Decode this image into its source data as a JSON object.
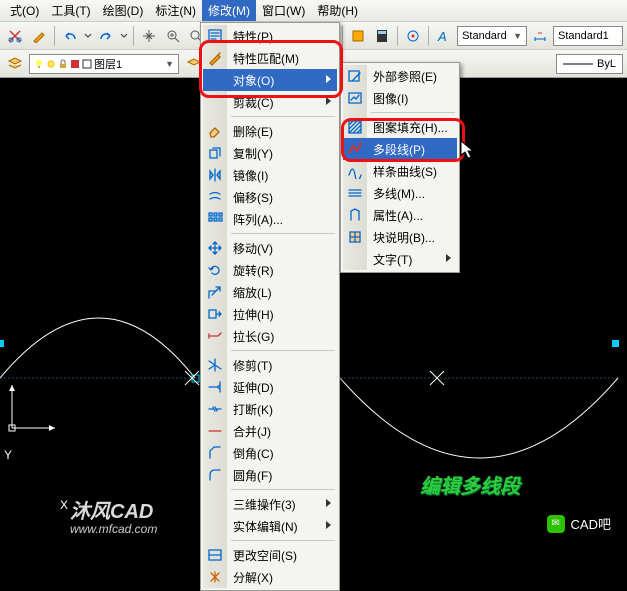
{
  "menubar": {
    "items": [
      {
        "label": "式(O)"
      },
      {
        "label": "工具(T)"
      },
      {
        "label": "绘图(D)"
      },
      {
        "label": "标注(N)"
      },
      {
        "label": "修改(M)",
        "active": true
      },
      {
        "label": "窗口(W)"
      },
      {
        "label": "帮助(H)"
      }
    ]
  },
  "toolbar": {
    "prop_label": "特性(P)",
    "style1": "Standard",
    "style2": "Standard1"
  },
  "layerbar": {
    "layer_label": "图层1",
    "bylayer": "ByL"
  },
  "menu1": {
    "items": [
      {
        "label": "特性(P)",
        "icon": "properties-icon"
      },
      {
        "label": "特性匹配(M)",
        "icon": "match-icon"
      },
      {
        "label": "对象(O)",
        "icon": "",
        "sub": true,
        "hot": true
      },
      {
        "label": "剪裁(C)",
        "icon": "",
        "sub": true
      },
      {
        "sep": true
      },
      {
        "label": "删除(E)",
        "icon": "erase-icon"
      },
      {
        "label": "复制(Y)",
        "icon": "copy-icon"
      },
      {
        "label": "镜像(I)",
        "icon": "mirror-icon"
      },
      {
        "label": "偏移(S)",
        "icon": "offset-icon"
      },
      {
        "label": "阵列(A)...",
        "icon": "array-icon"
      },
      {
        "sep": true
      },
      {
        "label": "移动(V)",
        "icon": "move-icon"
      },
      {
        "label": "旋转(R)",
        "icon": "rotate-icon"
      },
      {
        "label": "缩放(L)",
        "icon": "scale-icon"
      },
      {
        "label": "拉伸(H)",
        "icon": "stretch-icon"
      },
      {
        "label": "拉长(G)",
        "icon": "lengthen-icon"
      },
      {
        "sep": true
      },
      {
        "label": "修剪(T)",
        "icon": "trim-icon"
      },
      {
        "label": "延伸(D)",
        "icon": "extend-icon"
      },
      {
        "label": "打断(K)",
        "icon": "break-icon"
      },
      {
        "label": "合并(J)",
        "icon": "join-icon"
      },
      {
        "label": "倒角(C)",
        "icon": "chamfer-icon"
      },
      {
        "label": "圆角(F)",
        "icon": "fillet-icon"
      },
      {
        "sep": true
      },
      {
        "label": "三维操作(3)",
        "icon": "",
        "sub": true
      },
      {
        "label": "实体编辑(N)",
        "icon": "",
        "sub": true
      },
      {
        "sep": true
      },
      {
        "label": "更改空间(S)",
        "icon": "chspace-icon"
      },
      {
        "label": "分解(X)",
        "icon": "explode-icon"
      }
    ]
  },
  "menu2": {
    "items": [
      {
        "label": "外部参照(E)",
        "icon": "xref-icon"
      },
      {
        "label": "图像(I)",
        "icon": "image-icon"
      },
      {
        "sep": true
      },
      {
        "label": "图案填充(H)...",
        "icon": "hatch-icon"
      },
      {
        "label": "多段线(P)",
        "icon": "pline-icon",
        "hot": true
      },
      {
        "label": "样条曲线(S)",
        "icon": "spline-icon"
      },
      {
        "label": "多线(M)...",
        "icon": "mline-icon"
      },
      {
        "label": "属性(A)...",
        "icon": "attr-icon"
      },
      {
        "label": "块说明(B)...",
        "icon": "block-icon"
      },
      {
        "label": "文字(T)",
        "icon": "",
        "sub": true
      }
    ]
  },
  "annotations": {
    "green": "编辑多线段",
    "watermark": "沐风CAD",
    "wmurl": "www.mfcad.com",
    "cadba": "CAD吧"
  },
  "axis": {
    "x": "X",
    "y": "Y"
  }
}
